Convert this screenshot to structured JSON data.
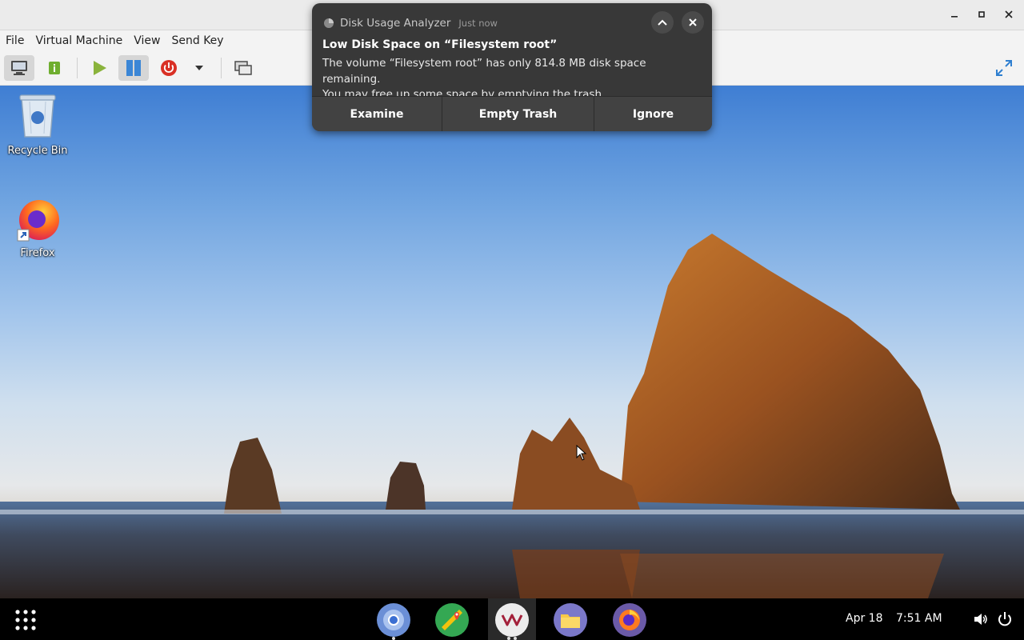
{
  "window": {
    "controls": {
      "minimize": "–",
      "maximize": "▫",
      "close": "✕"
    }
  },
  "menubar": {
    "items": [
      "File",
      "Virtual Machine",
      "View",
      "Send Key"
    ]
  },
  "toolbar": {
    "buttons": [
      "console-icon",
      "details-icon",
      "run-icon",
      "pause-icon",
      "shutdown-icon",
      "shutdown-menu-icon",
      "snapshot-icon"
    ],
    "fullscreen_icon": "fullscreen-icon"
  },
  "desktop": {
    "icons": [
      {
        "label": "Recycle Bin",
        "icon": "recycle-bin-icon"
      },
      {
        "label": "Firefox",
        "icon": "firefox-icon"
      }
    ]
  },
  "notification": {
    "app_name": "Disk Usage Analyzer",
    "time": "Just now",
    "title": "Low Disk Space on “Filesystem root”",
    "body_line1": "The volume “Filesystem root” has only 814.8 MB disk space remaining.",
    "body_line2": "You may free up some space by emptying the trash.",
    "actions": [
      "Examine",
      "Empty Trash",
      "Ignore"
    ]
  },
  "taskbar": {
    "apps": [
      "chrome-icon",
      "maps-icon",
      "vm-icon",
      "files-icon",
      "firefox-icon"
    ],
    "date": "Apr 18",
    "time": "7:51 AM"
  },
  "colors": {
    "accent_blue": "#3b86d6",
    "shutdown_red": "#d93025",
    "run_green": "#8ab33c"
  }
}
